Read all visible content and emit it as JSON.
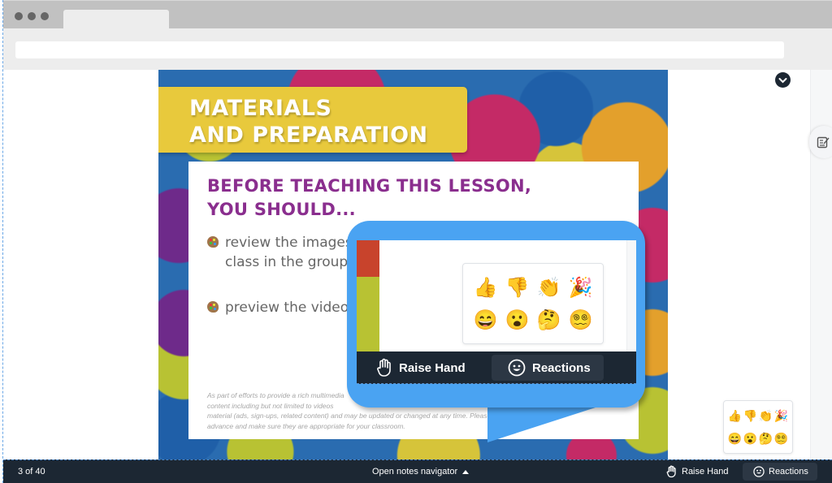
{
  "browser": {
    "tab_title": "",
    "url": ""
  },
  "slide": {
    "title_line1": "MATERIALS",
    "title_line2": "AND PREPARATION",
    "heading_line1": "BEFORE TEACHING THIS LESSON,",
    "heading_line2": "YOU SHOULD...",
    "bullets": [
      {
        "line1": "review the images",
        "line2": "class in the group"
      },
      {
        "line1": "preview the video",
        "line2": ""
      }
    ],
    "disclaimer": [
      "As part of efforts to provide a rich multimedia",
      "content including but not limited to videos",
      "material (ads, sign-ups, related content) and may be updated or changed at any time. Please preview",
      "advance and make sure they are appropriate for your classroom."
    ],
    "colors": {
      "title_bg": "#e8c93c",
      "heading": "#8a2e8e"
    }
  },
  "callout": {
    "color": "#4aa3f2",
    "raise_hand_label": "Raise Hand",
    "reactions_label": "Reactions"
  },
  "reactions": [
    {
      "name": "thumbs-up",
      "glyph": "👍"
    },
    {
      "name": "thumbs-down",
      "glyph": "👎"
    },
    {
      "name": "clapping-hands",
      "glyph": "👏"
    },
    {
      "name": "party-popper",
      "glyph": "🎉"
    },
    {
      "name": "grinning-face",
      "glyph": "😄"
    },
    {
      "name": "surprised-face",
      "glyph": "😮"
    },
    {
      "name": "thinking-face",
      "glyph": "🤔"
    },
    {
      "name": "dizzy-face",
      "glyph": "😵‍💫"
    }
  ],
  "bottombar": {
    "slide_counter": "3 of 40",
    "notes_navigator_label": "Open notes navigator",
    "raise_hand_label": "Raise Hand",
    "reactions_label": "Reactions"
  }
}
